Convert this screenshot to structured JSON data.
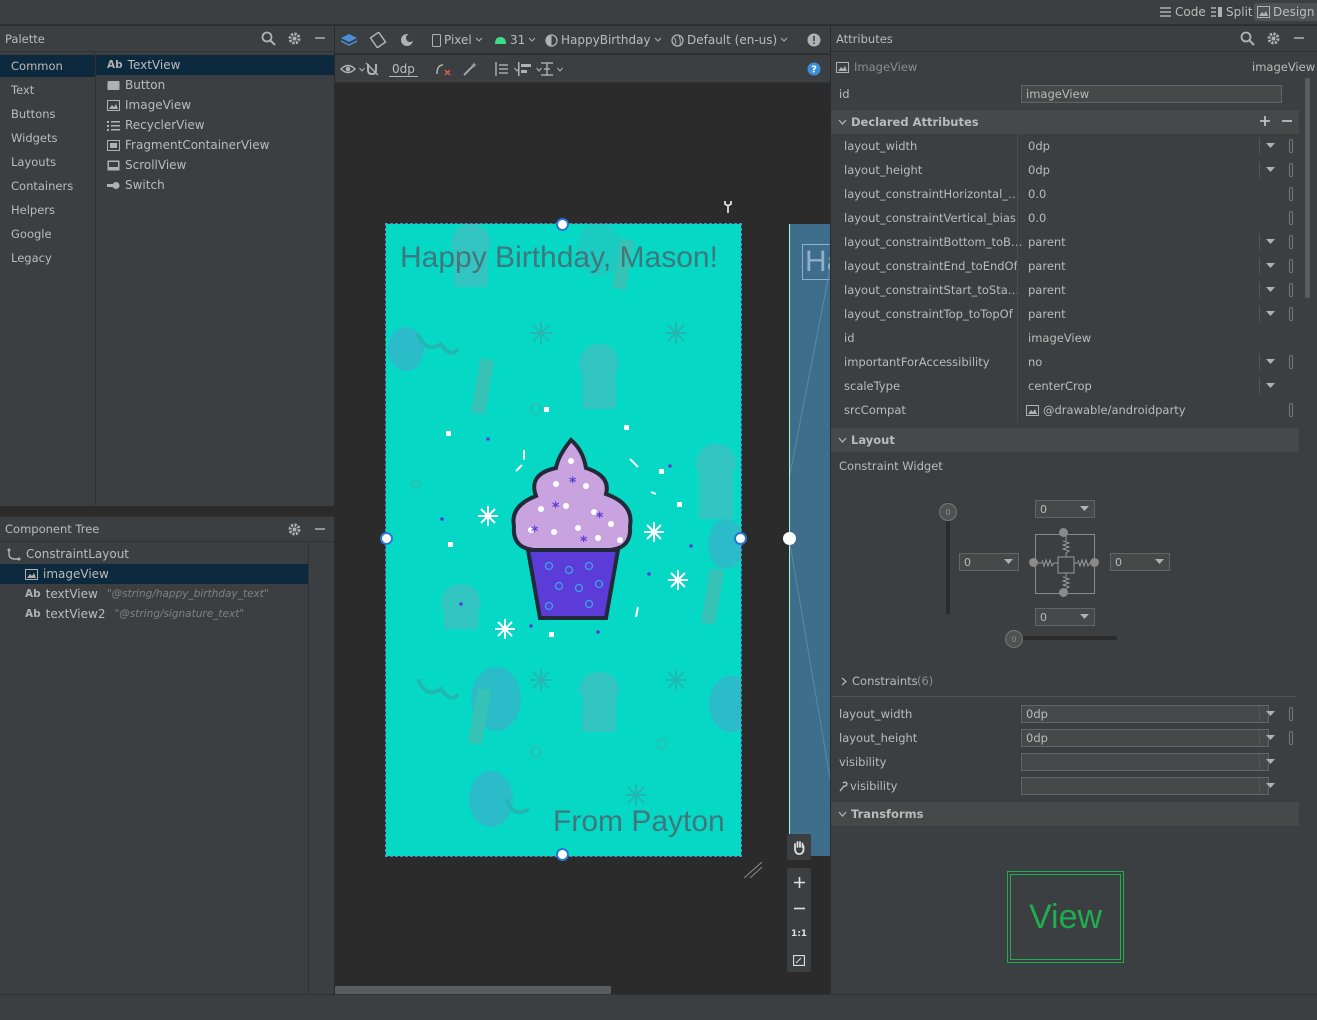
{
  "topbar": {
    "code_label": "Code",
    "split_label": "Split",
    "design_label": "Design"
  },
  "palette": {
    "title": "Palette",
    "categories": [
      "Common",
      "Text",
      "Buttons",
      "Widgets",
      "Layouts",
      "Containers",
      "Helpers",
      "Google",
      "Legacy"
    ],
    "items": [
      {
        "label": "TextView",
        "icon": "textview-icon"
      },
      {
        "label": "Button",
        "icon": "button-icon"
      },
      {
        "label": "ImageView",
        "icon": "imageview-icon"
      },
      {
        "label": "RecyclerView",
        "icon": "recyclerview-icon"
      },
      {
        "label": "FragmentContainerView",
        "icon": "fragment-icon"
      },
      {
        "label": "ScrollView",
        "icon": "scrollview-icon"
      },
      {
        "label": "Switch",
        "icon": "switch-icon"
      }
    ]
  },
  "component_tree": {
    "title": "Component Tree",
    "root": "ConstraintLayout",
    "children": [
      {
        "name": "imageView",
        "hint": ""
      },
      {
        "name": "textView",
        "hint": "\"@string/happy_birthday_text\""
      },
      {
        "name": "textView2",
        "hint": "\"@string/signature_text\""
      }
    ]
  },
  "design_toolbar": {
    "device": "Pixel",
    "api": "31",
    "theme": "HappyBirthday",
    "locale": "Default (en-us)",
    "margin": "0dp"
  },
  "preview": {
    "title_text": "Happy Birthday, Mason!",
    "signature_text": "From Payton",
    "blueprint_letters": "Ha",
    "background_color": "#05d9c6"
  },
  "zoom": {
    "one_to_one": "1:1"
  },
  "attributes": {
    "title": "Attributes",
    "widget_type": "ImageView",
    "widget_id": "imageView",
    "id_label": "id",
    "id_value": "imageView",
    "declared_title": "Declared Attributes",
    "declared": [
      {
        "name": "layout_width",
        "value": "0dp",
        "dropdown": true
      },
      {
        "name": "layout_height",
        "value": "0dp",
        "dropdown": true
      },
      {
        "name": "layout_constraintHorizontal_bias",
        "value": "0.0",
        "dropdown": false
      },
      {
        "name": "layout_constraintVertical_bias",
        "value": "0.0",
        "dropdown": false
      },
      {
        "name": "layout_constraintBottom_toBott...",
        "value": "parent",
        "dropdown": true
      },
      {
        "name": "layout_constraintEnd_toEndOf",
        "value": "parent",
        "dropdown": true
      },
      {
        "name": "layout_constraintStart_toStartOf",
        "value": "parent",
        "dropdown": true
      },
      {
        "name": "layout_constraintTop_toTopOf",
        "value": "parent",
        "dropdown": true
      },
      {
        "name": "id",
        "value": "imageView",
        "dropdown": false
      },
      {
        "name": "importantForAccessibility",
        "value": "no",
        "dropdown": true
      },
      {
        "name": "scaleType",
        "value": "centerCrop",
        "dropdown": true
      },
      {
        "name": "srcCompat",
        "value": "@drawable/androidparty",
        "dropdown": false
      }
    ],
    "layout_title": "Layout",
    "constraint_widget_label": "Constraint Widget",
    "margins": {
      "top": "0",
      "left": "0",
      "right": "0",
      "bottom": "0"
    },
    "constraints_label": "Constraints",
    "constraints_count": "(6)",
    "layout_rows": [
      {
        "name": "layout_width",
        "value": "0dp"
      },
      {
        "name": "layout_height",
        "value": "0dp"
      },
      {
        "name": "visibility",
        "value": ""
      },
      {
        "name": "visibility",
        "value": ""
      }
    ],
    "transforms_title": "Transforms",
    "view_label": "View"
  },
  "colors": {
    "selection": "#0d293e",
    "accent_green": "#1fae4f",
    "cupcake_purple": "#5b3cd9",
    "frosting": "#c9a2e0"
  }
}
